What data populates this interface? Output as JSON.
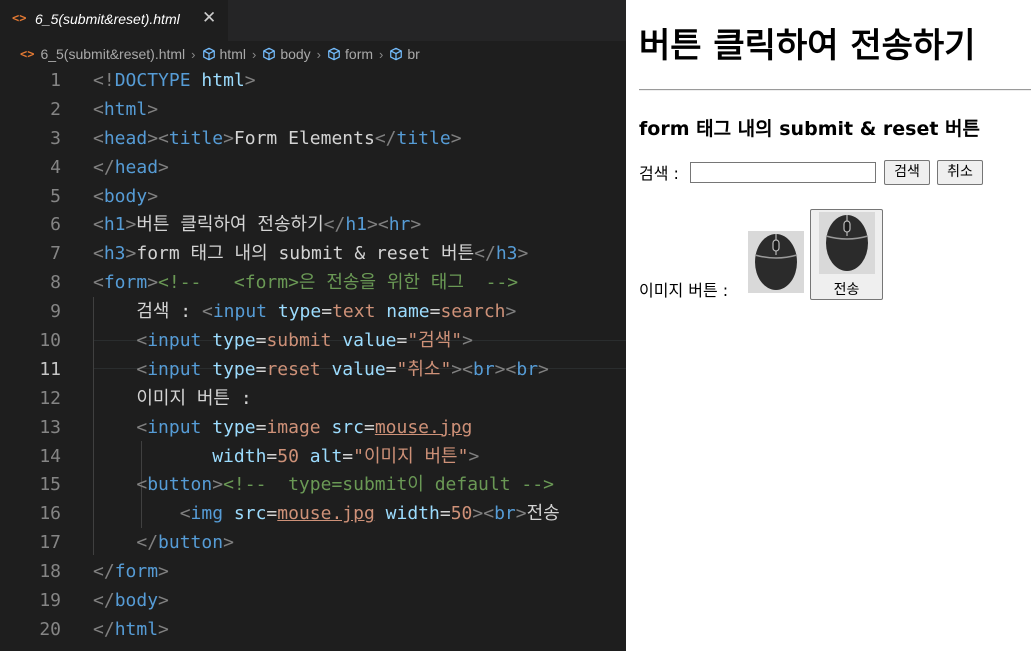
{
  "tab": {
    "icon": "<>",
    "label": "6_5(submit&reset).html",
    "close": "✕"
  },
  "breadcrumb": {
    "file_icon": "<>",
    "file": "6_5(submit&reset).html",
    "items": [
      "html",
      "body",
      "form",
      "br"
    ]
  },
  "editor": {
    "line_numbers": [
      "1",
      "2",
      "3",
      "4",
      "5",
      "6",
      "7",
      "8",
      "9",
      "10",
      "11",
      "12",
      "13",
      "14",
      "15",
      "16",
      "17",
      "18",
      "19",
      "20"
    ],
    "active_line": "11",
    "lines": [
      [
        [
          "p",
          "<!"
        ],
        [
          "t",
          "DOCTYPE"
        ],
        [
          "tx",
          " "
        ],
        [
          "a",
          "html"
        ],
        [
          "p",
          ">"
        ]
      ],
      [
        [
          "p",
          "<"
        ],
        [
          "t",
          "html"
        ],
        [
          "p",
          ">"
        ]
      ],
      [
        [
          "p",
          "<"
        ],
        [
          "t",
          "head"
        ],
        [
          "p",
          "><"
        ],
        [
          "t",
          "title"
        ],
        [
          "p",
          ">"
        ],
        [
          "tx",
          "Form Elements"
        ],
        [
          "p",
          "</"
        ],
        [
          "t",
          "title"
        ],
        [
          "p",
          ">"
        ]
      ],
      [
        [
          "p",
          "</"
        ],
        [
          "t",
          "head"
        ],
        [
          "p",
          ">"
        ]
      ],
      [
        [
          "p",
          "<"
        ],
        [
          "t",
          "body"
        ],
        [
          "p",
          ">"
        ]
      ],
      [
        [
          "p",
          "<"
        ],
        [
          "t",
          "h1"
        ],
        [
          "p",
          ">"
        ],
        [
          "tx",
          "버튼 클릭하여 전송하기"
        ],
        [
          "p",
          "</"
        ],
        [
          "t",
          "h1"
        ],
        [
          "p",
          "><"
        ],
        [
          "t",
          "hr"
        ],
        [
          "p",
          ">"
        ]
      ],
      [
        [
          "p",
          "<"
        ],
        [
          "t",
          "h3"
        ],
        [
          "p",
          ">"
        ],
        [
          "tx",
          "form 태그 내의 submit & reset 버튼"
        ],
        [
          "p",
          "</"
        ],
        [
          "t",
          "h3"
        ],
        [
          "p",
          ">"
        ]
      ],
      [
        [
          "p",
          "<"
        ],
        [
          "t",
          "form"
        ],
        [
          "p",
          ">"
        ],
        [
          "cm",
          "<!--   <form>은 전송을 위한 태그  -->"
        ]
      ],
      [
        [
          "tx",
          "    검색 : "
        ],
        [
          "p",
          "<"
        ],
        [
          "t",
          "input"
        ],
        [
          "tx",
          " "
        ],
        [
          "a",
          "type"
        ],
        [
          "tx",
          "="
        ],
        [
          "v",
          "text"
        ],
        [
          "tx",
          " "
        ],
        [
          "a",
          "name"
        ],
        [
          "tx",
          "="
        ],
        [
          "v",
          "search"
        ],
        [
          "p",
          ">"
        ]
      ],
      [
        [
          "tx",
          "    "
        ],
        [
          "p",
          "<"
        ],
        [
          "t",
          "input"
        ],
        [
          "tx",
          " "
        ],
        [
          "a",
          "type"
        ],
        [
          "tx",
          "="
        ],
        [
          "v",
          "submit"
        ],
        [
          "tx",
          " "
        ],
        [
          "a",
          "value"
        ],
        [
          "tx",
          "="
        ],
        [
          "v",
          "\"검색\""
        ],
        [
          "p",
          ">"
        ]
      ],
      [
        [
          "tx",
          "    "
        ],
        [
          "p",
          "<"
        ],
        [
          "t",
          "input"
        ],
        [
          "tx",
          " "
        ],
        [
          "a",
          "type"
        ],
        [
          "tx",
          "="
        ],
        [
          "v",
          "reset"
        ],
        [
          "tx",
          " "
        ],
        [
          "a",
          "value"
        ],
        [
          "tx",
          "="
        ],
        [
          "v",
          "\"취소\""
        ],
        [
          "p",
          "><"
        ],
        [
          "t",
          "br"
        ],
        [
          "p",
          "><"
        ],
        [
          "t",
          "br"
        ],
        [
          "p",
          ">"
        ]
      ],
      [
        [
          "tx",
          "    이미지 버튼 :"
        ]
      ],
      [
        [
          "tx",
          "    "
        ],
        [
          "p",
          "<"
        ],
        [
          "t",
          "input"
        ],
        [
          "tx",
          " "
        ],
        [
          "a",
          "type"
        ],
        [
          "tx",
          "="
        ],
        [
          "v",
          "image"
        ],
        [
          "tx",
          " "
        ],
        [
          "a",
          "src"
        ],
        [
          "tx",
          "="
        ],
        [
          "vu",
          "mouse.jpg"
        ]
      ],
      [
        [
          "tx",
          "           "
        ],
        [
          "a",
          "width"
        ],
        [
          "tx",
          "="
        ],
        [
          "v",
          "50"
        ],
        [
          "tx",
          " "
        ],
        [
          "a",
          "alt"
        ],
        [
          "tx",
          "="
        ],
        [
          "v",
          "\"이미지 버튼\""
        ],
        [
          "p",
          ">"
        ]
      ],
      [
        [
          "tx",
          "    "
        ],
        [
          "p",
          "<"
        ],
        [
          "t",
          "button"
        ],
        [
          "p",
          ">"
        ],
        [
          "cm",
          "<!--  type=submit이 default -->"
        ]
      ],
      [
        [
          "tx",
          "        "
        ],
        [
          "p",
          "<"
        ],
        [
          "t",
          "img"
        ],
        [
          "tx",
          " "
        ],
        [
          "a",
          "src"
        ],
        [
          "tx",
          "="
        ],
        [
          "vu",
          "mouse.jpg"
        ],
        [
          "tx",
          " "
        ],
        [
          "a",
          "width"
        ],
        [
          "tx",
          "="
        ],
        [
          "v",
          "50"
        ],
        [
          "p",
          "><"
        ],
        [
          "t",
          "br"
        ],
        [
          "p",
          ">"
        ],
        [
          "tx",
          "전송"
        ]
      ],
      [
        [
          "tx",
          "    "
        ],
        [
          "p",
          "</"
        ],
        [
          "t",
          "button"
        ],
        [
          "p",
          ">"
        ]
      ],
      [
        [
          "p",
          "</"
        ],
        [
          "t",
          "form"
        ],
        [
          "p",
          ">"
        ]
      ],
      [
        [
          "p",
          "</"
        ],
        [
          "t",
          "body"
        ],
        [
          "p",
          ">"
        ]
      ],
      [
        [
          "p",
          "</"
        ],
        [
          "t",
          "html"
        ],
        [
          "p",
          ">"
        ]
      ]
    ]
  },
  "preview": {
    "h1": "버튼 클릭하여 전송하기",
    "h3": "form 태그 내의 submit & reset 버튼",
    "search_label": "검색 :",
    "submit_label": "검색",
    "reset_label": "취소",
    "image_label": "이미지 버튼 :",
    "button_label": "전송"
  }
}
